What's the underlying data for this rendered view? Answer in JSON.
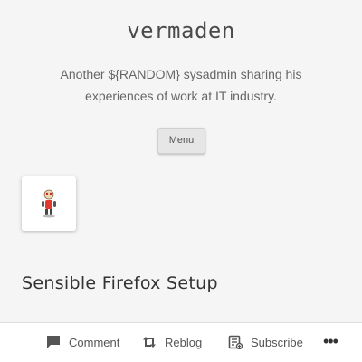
{
  "site": {
    "title": "vermaden",
    "tagline": "Another ${RANDOM} sysadmin sharing his experiences of work at IT industry."
  },
  "nav": {
    "menu_label": "Menu"
  },
  "post": {
    "title": "Sensible Firefox Setup",
    "avatar_icon": "red-robot-mascot-icon"
  },
  "action_bar": {
    "comment_label": "Comment",
    "reblog_label": "Reblog",
    "subscribe_label": "Subscribe",
    "more_label": "•••"
  },
  "colors": {
    "background": "#f5f5f5",
    "action_bar": "#ffffff",
    "avatar_accent": "#e03a2f"
  }
}
